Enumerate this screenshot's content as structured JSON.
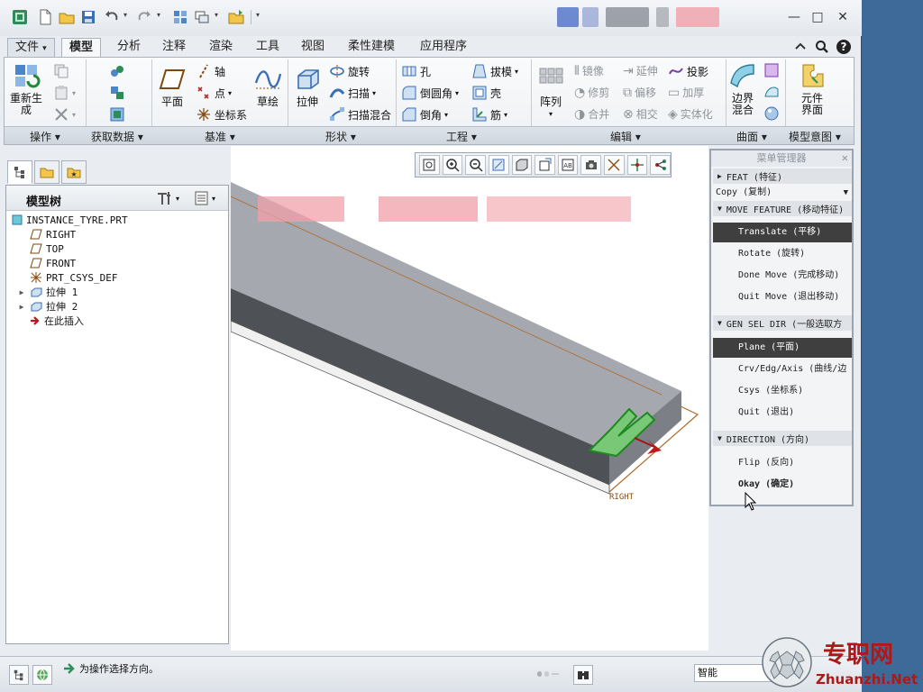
{
  "window": {
    "minimize_label": "—",
    "restore_label": "□",
    "close_label": "✕"
  },
  "tabs": [
    {
      "label": "文件",
      "arrow": "▾"
    },
    {
      "label": "模型"
    },
    {
      "label": "分析"
    },
    {
      "label": "注释"
    },
    {
      "label": "渲染"
    },
    {
      "label": "工具"
    },
    {
      "label": "视图"
    },
    {
      "label": "柔性建模"
    },
    {
      "label": "应用程序"
    }
  ],
  "ribbon": {
    "regenerate_label_line1": "重新生",
    "regenerate_label_line2": "成",
    "axis_label": "轴",
    "point_label": "点",
    "csys_label": "坐标系",
    "plane_label": "平面",
    "sketch_label": "草绘",
    "extrude_label": "拉伸",
    "revolve_label": "旋转",
    "sweep_label": "扫描",
    "swept_blend_label": "扫描混合",
    "hole_label": "孔",
    "round_label": "倒圆角",
    "chamfer_label": "倒角",
    "draft_label": "拔模",
    "shell_label": "壳",
    "rib_label": "筋",
    "pattern_label": "阵列",
    "mirror_label": "镜像",
    "modify_label": "修剪",
    "merge_label": "合并",
    "extend_label": "延伸",
    "offset_label": "偏移",
    "intersect_label": "相交",
    "project_label": "投影",
    "thicken_label": "加厚",
    "solidify_label": "实体化",
    "boundary_blend_line1": "边界",
    "boundary_blend_line2": "混合",
    "component_interface_line1": "元件",
    "component_interface_line2": "界面",
    "groups": [
      {
        "label": "操作"
      },
      {
        "label": "获取数据"
      },
      {
        "label": "基准"
      },
      {
        "label": "形状"
      },
      {
        "label": "工程"
      },
      {
        "label": "编辑"
      },
      {
        "label": "曲面"
      },
      {
        "label": "模型意图"
      }
    ]
  },
  "model_tree": {
    "title": "模型树",
    "items": [
      {
        "label": "INSTANCE_TYRE.PRT"
      },
      {
        "label": "RIGHT"
      },
      {
        "label": "TOP"
      },
      {
        "label": "FRONT"
      },
      {
        "label": "PRT_CSYS_DEF"
      },
      {
        "label": "拉伸 1"
      },
      {
        "label": "拉伸 2"
      },
      {
        "label": "在此插入"
      }
    ]
  },
  "viewport": {
    "plane_label": "RIGHT"
  },
  "menu_manager": {
    "title": "菜单管理器",
    "close": "✕",
    "feat_section": "FEAT (特征)",
    "copy_value": "Copy (复制)",
    "move_feature_section": "MOVE FEATURE (移动特征)",
    "move_items": [
      {
        "label": "Translate (平移)"
      },
      {
        "label": "Rotate (旋转)"
      },
      {
        "label": "Done Move (完成移动)"
      },
      {
        "label": "Quit Move (退出移动)"
      }
    ],
    "gen_sel_dir_section": "GEN SEL DIR (一般选取方",
    "dir_items": [
      {
        "label": "Plane (平面)"
      },
      {
        "label": "Crv/Edg/Axis (曲线/边"
      },
      {
        "label": "Csys (坐标系)"
      },
      {
        "label": "Quit (退出)"
      }
    ],
    "direction_section": "DIRECTION (方向)",
    "direction_items": [
      {
        "label": "Flip (反向)"
      },
      {
        "label": "Okay (确定)"
      }
    ]
  },
  "statusbar": {
    "message": "为操作选择方向。",
    "filter_value": "智能"
  },
  "watermark": {
    "name": "专职网",
    "url": "Zhuanzhi.Net"
  }
}
